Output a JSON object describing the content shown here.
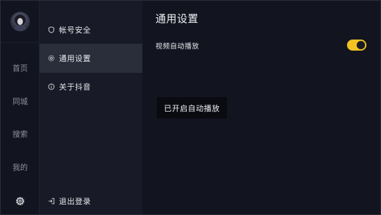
{
  "rail": {
    "items": [
      {
        "label": "首页"
      },
      {
        "label": "同城"
      },
      {
        "label": "搜索"
      },
      {
        "label": "我的"
      }
    ],
    "settings_icon": "gear-icon"
  },
  "menu": {
    "items": [
      {
        "label": "帐号安全",
        "icon": "shield-icon",
        "active": false
      },
      {
        "label": "通用设置",
        "icon": "gear-icon",
        "active": true
      },
      {
        "label": "关于抖音",
        "icon": "info-icon",
        "active": false
      }
    ],
    "logout": {
      "label": "退出登录",
      "icon": "logout-icon"
    }
  },
  "content": {
    "title": "通用设置",
    "settings": [
      {
        "label": "视频自动播放",
        "enabled": true
      }
    ],
    "toast": "已开启自动播放"
  },
  "colors": {
    "accent": "#f2c322",
    "background": "#121520",
    "menu_background": "#181b27",
    "active_item": "#2a2e3b"
  }
}
